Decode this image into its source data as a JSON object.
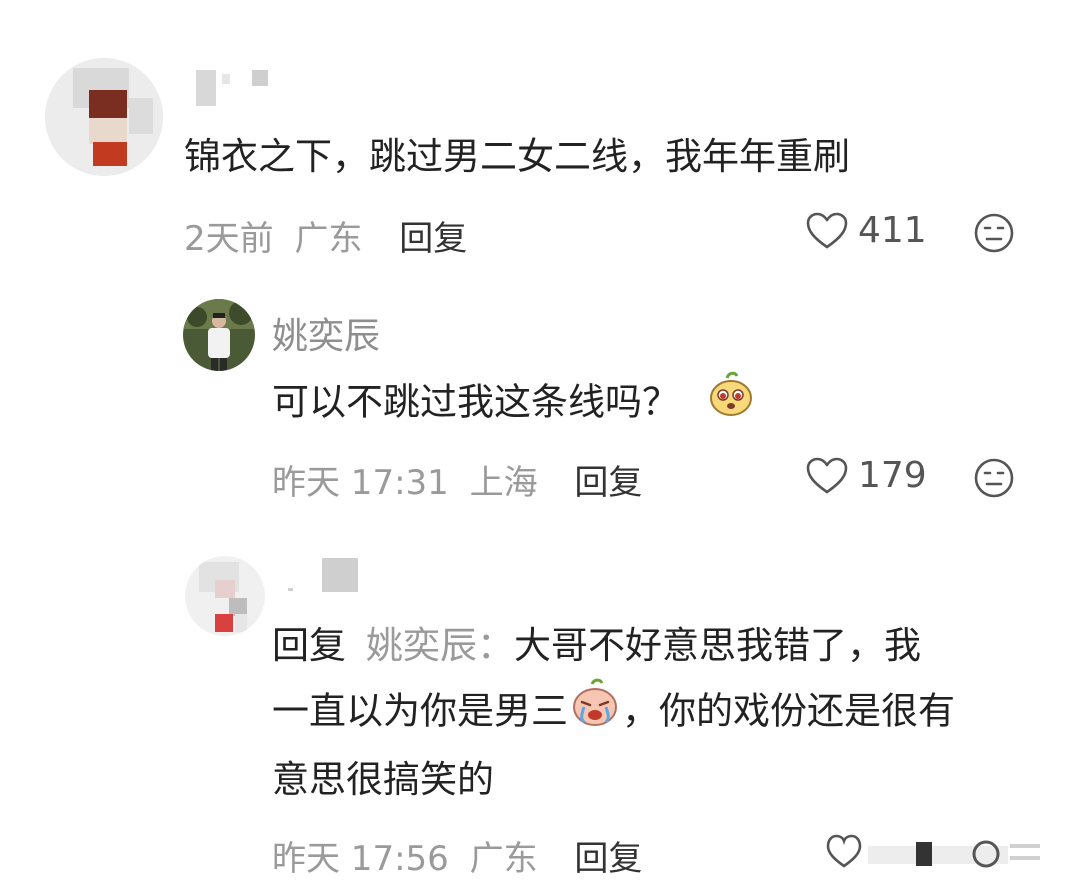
{
  "comment1": {
    "text": "锦衣之下，跳过男二女二线，我年年重刷",
    "time": "2天前",
    "location": "广东",
    "reply_label": "回复",
    "likes": "411",
    "avatar_icon": "pixelated-avatar-icon"
  },
  "comment2": {
    "name": "姚奕辰",
    "text": "可以不跳过我这条线吗？",
    "emoji_icon": "pear-face-emoji-icon",
    "time": "昨天 17:31",
    "location": "上海",
    "reply_label": "回复",
    "likes": "179"
  },
  "comment3": {
    "reply_prefix": "回复",
    "reply_target": "姚奕辰：",
    "text_part1": "大哥不好意思我错了，我",
    "text_part2a": "一直以为你是男三",
    "text_part2b": "，你的戏份还是很有",
    "text_part3": "意思很搞笑的",
    "emoji_icon": "crying-emoji-icon",
    "time": "昨天 17:56",
    "location": "广东",
    "reply_label": "回复"
  },
  "colors": {
    "text": "#222222",
    "secondary": "#9a9a9a",
    "background": "#ffffff"
  }
}
